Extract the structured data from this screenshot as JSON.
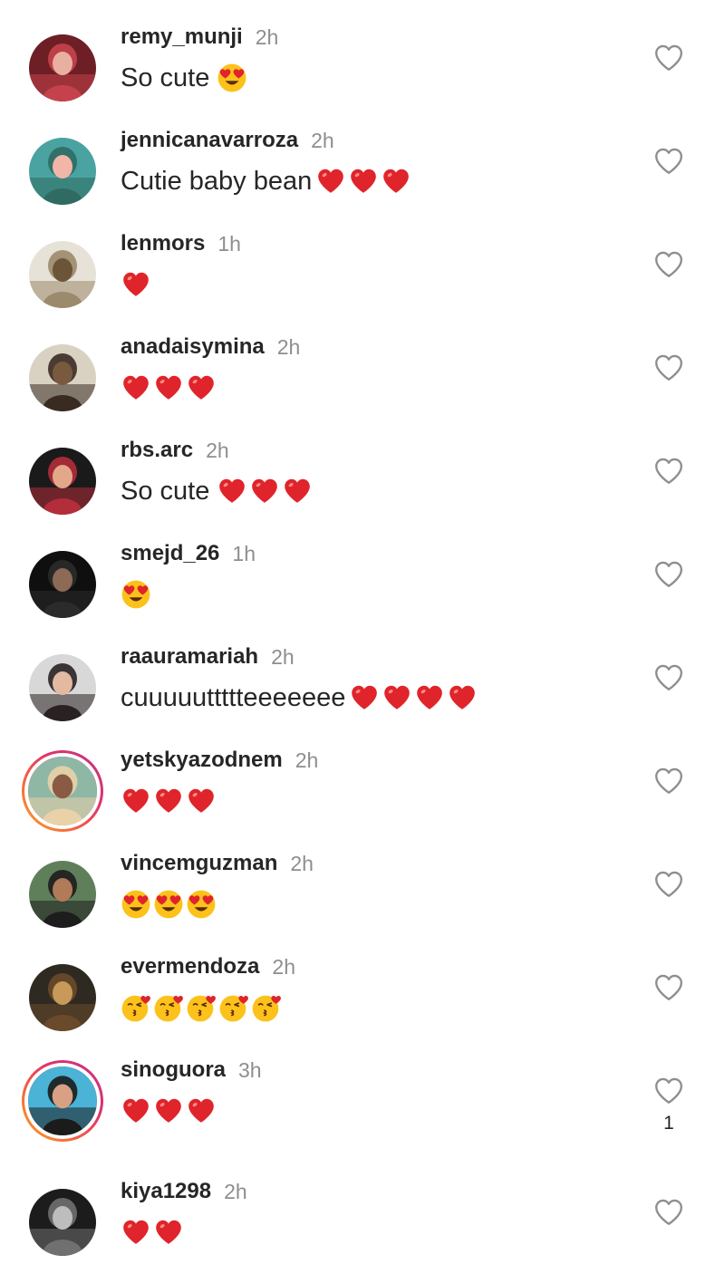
{
  "comments": [
    {
      "username": "remy_munji",
      "time": "2h",
      "text": "So cute",
      "emojis": [
        "heart-eyes-emoji"
      ],
      "story_ring": false,
      "like_count": "",
      "avatar_colors": [
        "#6d1f25",
        "#e8b0a0",
        "#c5424c"
      ]
    },
    {
      "username": "jennicanavarroza",
      "time": "2h",
      "text": "Cutie baby bean",
      "emojis": [
        "red-heart-emoji",
        "red-heart-emoji",
        "red-heart-emoji"
      ],
      "story_ring": false,
      "like_count": "",
      "avatar_colors": [
        "#4aa3a0",
        "#f2b6a8",
        "#2f6b63"
      ]
    },
    {
      "username": "lenmors",
      "time": "1h",
      "text": "",
      "emojis": [
        "red-heart-emoji"
      ],
      "story_ring": false,
      "like_count": "",
      "avatar_colors": [
        "#e7e2d8",
        "#6b5438",
        "#9c8a6c"
      ]
    },
    {
      "username": "anadaisymina",
      "time": "2h",
      "text": "",
      "emojis": [
        "red-heart-emoji",
        "red-heart-emoji",
        "red-heart-emoji"
      ],
      "story_ring": false,
      "like_count": "",
      "avatar_colors": [
        "#d9d2c3",
        "#7a5a3f",
        "#3a2b22"
      ]
    },
    {
      "username": "rbs.arc",
      "time": "2h",
      "text": "So cute",
      "emojis": [
        "red-heart-emoji",
        "red-heart-emoji",
        "red-heart-emoji"
      ],
      "story_ring": false,
      "like_count": "",
      "avatar_colors": [
        "#1a1a1a",
        "#e3a88a",
        "#b32d3a"
      ]
    },
    {
      "username": "smejd_26",
      "time": "1h",
      "text": "",
      "emojis": [
        "heart-eyes-emoji"
      ],
      "story_ring": false,
      "like_count": "",
      "avatar_colors": [
        "#0f0f0f",
        "#8c6a55",
        "#2b2b2b"
      ]
    },
    {
      "username": "raauramariah",
      "time": "2h",
      "text": "cuuuuuttttteeeeeee",
      "emojis": [
        "red-heart-emoji",
        "red-heart-emoji",
        "red-heart-emoji",
        "red-heart-emoji"
      ],
      "story_ring": false,
      "like_count": "",
      "avatar_colors": [
        "#d8d8d8",
        "#e3b9a2",
        "#2a2222"
      ]
    },
    {
      "username": "yetskyazodnem",
      "time": "2h",
      "text": "",
      "emojis": [
        "red-heart-emoji",
        "red-heart-emoji",
        "red-heart-emoji"
      ],
      "story_ring": true,
      "like_count": "",
      "avatar_colors": [
        "#8fb7a6",
        "#8a5a44",
        "#e9d2a8"
      ]
    },
    {
      "username": "vincemguzman",
      "time": "2h",
      "text": "",
      "emojis": [
        "heart-eyes-emoji",
        "heart-eyes-emoji",
        "heart-eyes-emoji"
      ],
      "story_ring": false,
      "like_count": "",
      "avatar_colors": [
        "#5f7f5a",
        "#b17a58",
        "#1d1d1d"
      ]
    },
    {
      "username": "evermendoza",
      "time": "2h",
      "text": "",
      "emojis": [
        "kissing-heart-emoji",
        "kissing-heart-emoji",
        "kissing-heart-emoji",
        "kissing-heart-emoji",
        "kissing-heart-emoji"
      ],
      "story_ring": false,
      "like_count": "",
      "avatar_colors": [
        "#2e2a22",
        "#c79a5a",
        "#6a4a2a"
      ]
    },
    {
      "username": "sinoguora",
      "time": "3h",
      "text": "",
      "emojis": [
        "red-heart-emoji",
        "red-heart-emoji",
        "red-heart-emoji"
      ],
      "story_ring": true,
      "like_count": "1",
      "avatar_colors": [
        "#4ab3d6",
        "#d9a184",
        "#1b1b1b"
      ]
    },
    {
      "username": "kiya1298",
      "time": "2h",
      "text": "",
      "emojis": [
        "red-heart-emoji",
        "red-heart-emoji"
      ],
      "story_ring": false,
      "like_count": "",
      "avatar_colors": [
        "#1c1c1c",
        "#bdbdbd",
        "#707070"
      ]
    }
  ]
}
